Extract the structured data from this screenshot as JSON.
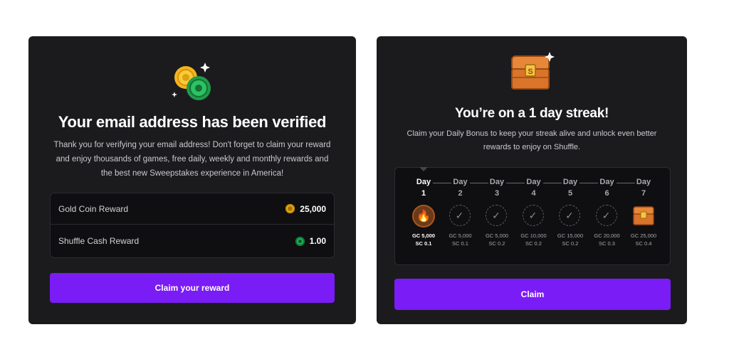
{
  "verified_card": {
    "title": "Your email address has been verified",
    "description": "Thank you for verifying your email address! Don't forget to claim your reward and enjoy thousands of games, free daily, weekly and monthly rewards and the best new Sweepstakes experience in America!",
    "rewards": [
      {
        "label": "Gold Coin Reward",
        "value": "25,000",
        "icon": "gold-coin-icon"
      },
      {
        "label": "Shuffle Cash Reward",
        "value": "1.00",
        "icon": "shuffle-cash-icon"
      }
    ],
    "button_label": "Claim your reward"
  },
  "streak_card": {
    "title": "You’re on a 1 day streak!",
    "description": "Claim your Daily Bonus to keep your streak alive and unlock even better rewards to enjoy on Shuffle.",
    "days": [
      {
        "label": "Day",
        "num": "1",
        "gc": "GC 5,000",
        "sc": "SC 0.1",
        "state": "active"
      },
      {
        "label": "Day",
        "num": "2",
        "gc": "GC 5,000",
        "sc": "SC 0.1",
        "state": "locked"
      },
      {
        "label": "Day",
        "num": "3",
        "gc": "GC 5,000",
        "sc": "SC 0.2",
        "state": "locked"
      },
      {
        "label": "Day",
        "num": "4",
        "gc": "GC 10,000",
        "sc": "SC 0.2",
        "state": "locked"
      },
      {
        "label": "Day",
        "num": "5",
        "gc": "GC 15,000",
        "sc": "SC 0.2",
        "state": "locked"
      },
      {
        "label": "Day",
        "num": "6",
        "gc": "GC 20,000",
        "sc": "SC 0.3",
        "state": "locked"
      },
      {
        "label": "Day",
        "num": "7",
        "gc": "GC 25,000",
        "sc": "SC 0.4",
        "state": "chest"
      }
    ],
    "button_label": "Claim"
  },
  "colors": {
    "card_bg": "#1b1b1e",
    "button": "#7a1cf5",
    "gold": "#f3c21a",
    "green": "#22b35a"
  }
}
